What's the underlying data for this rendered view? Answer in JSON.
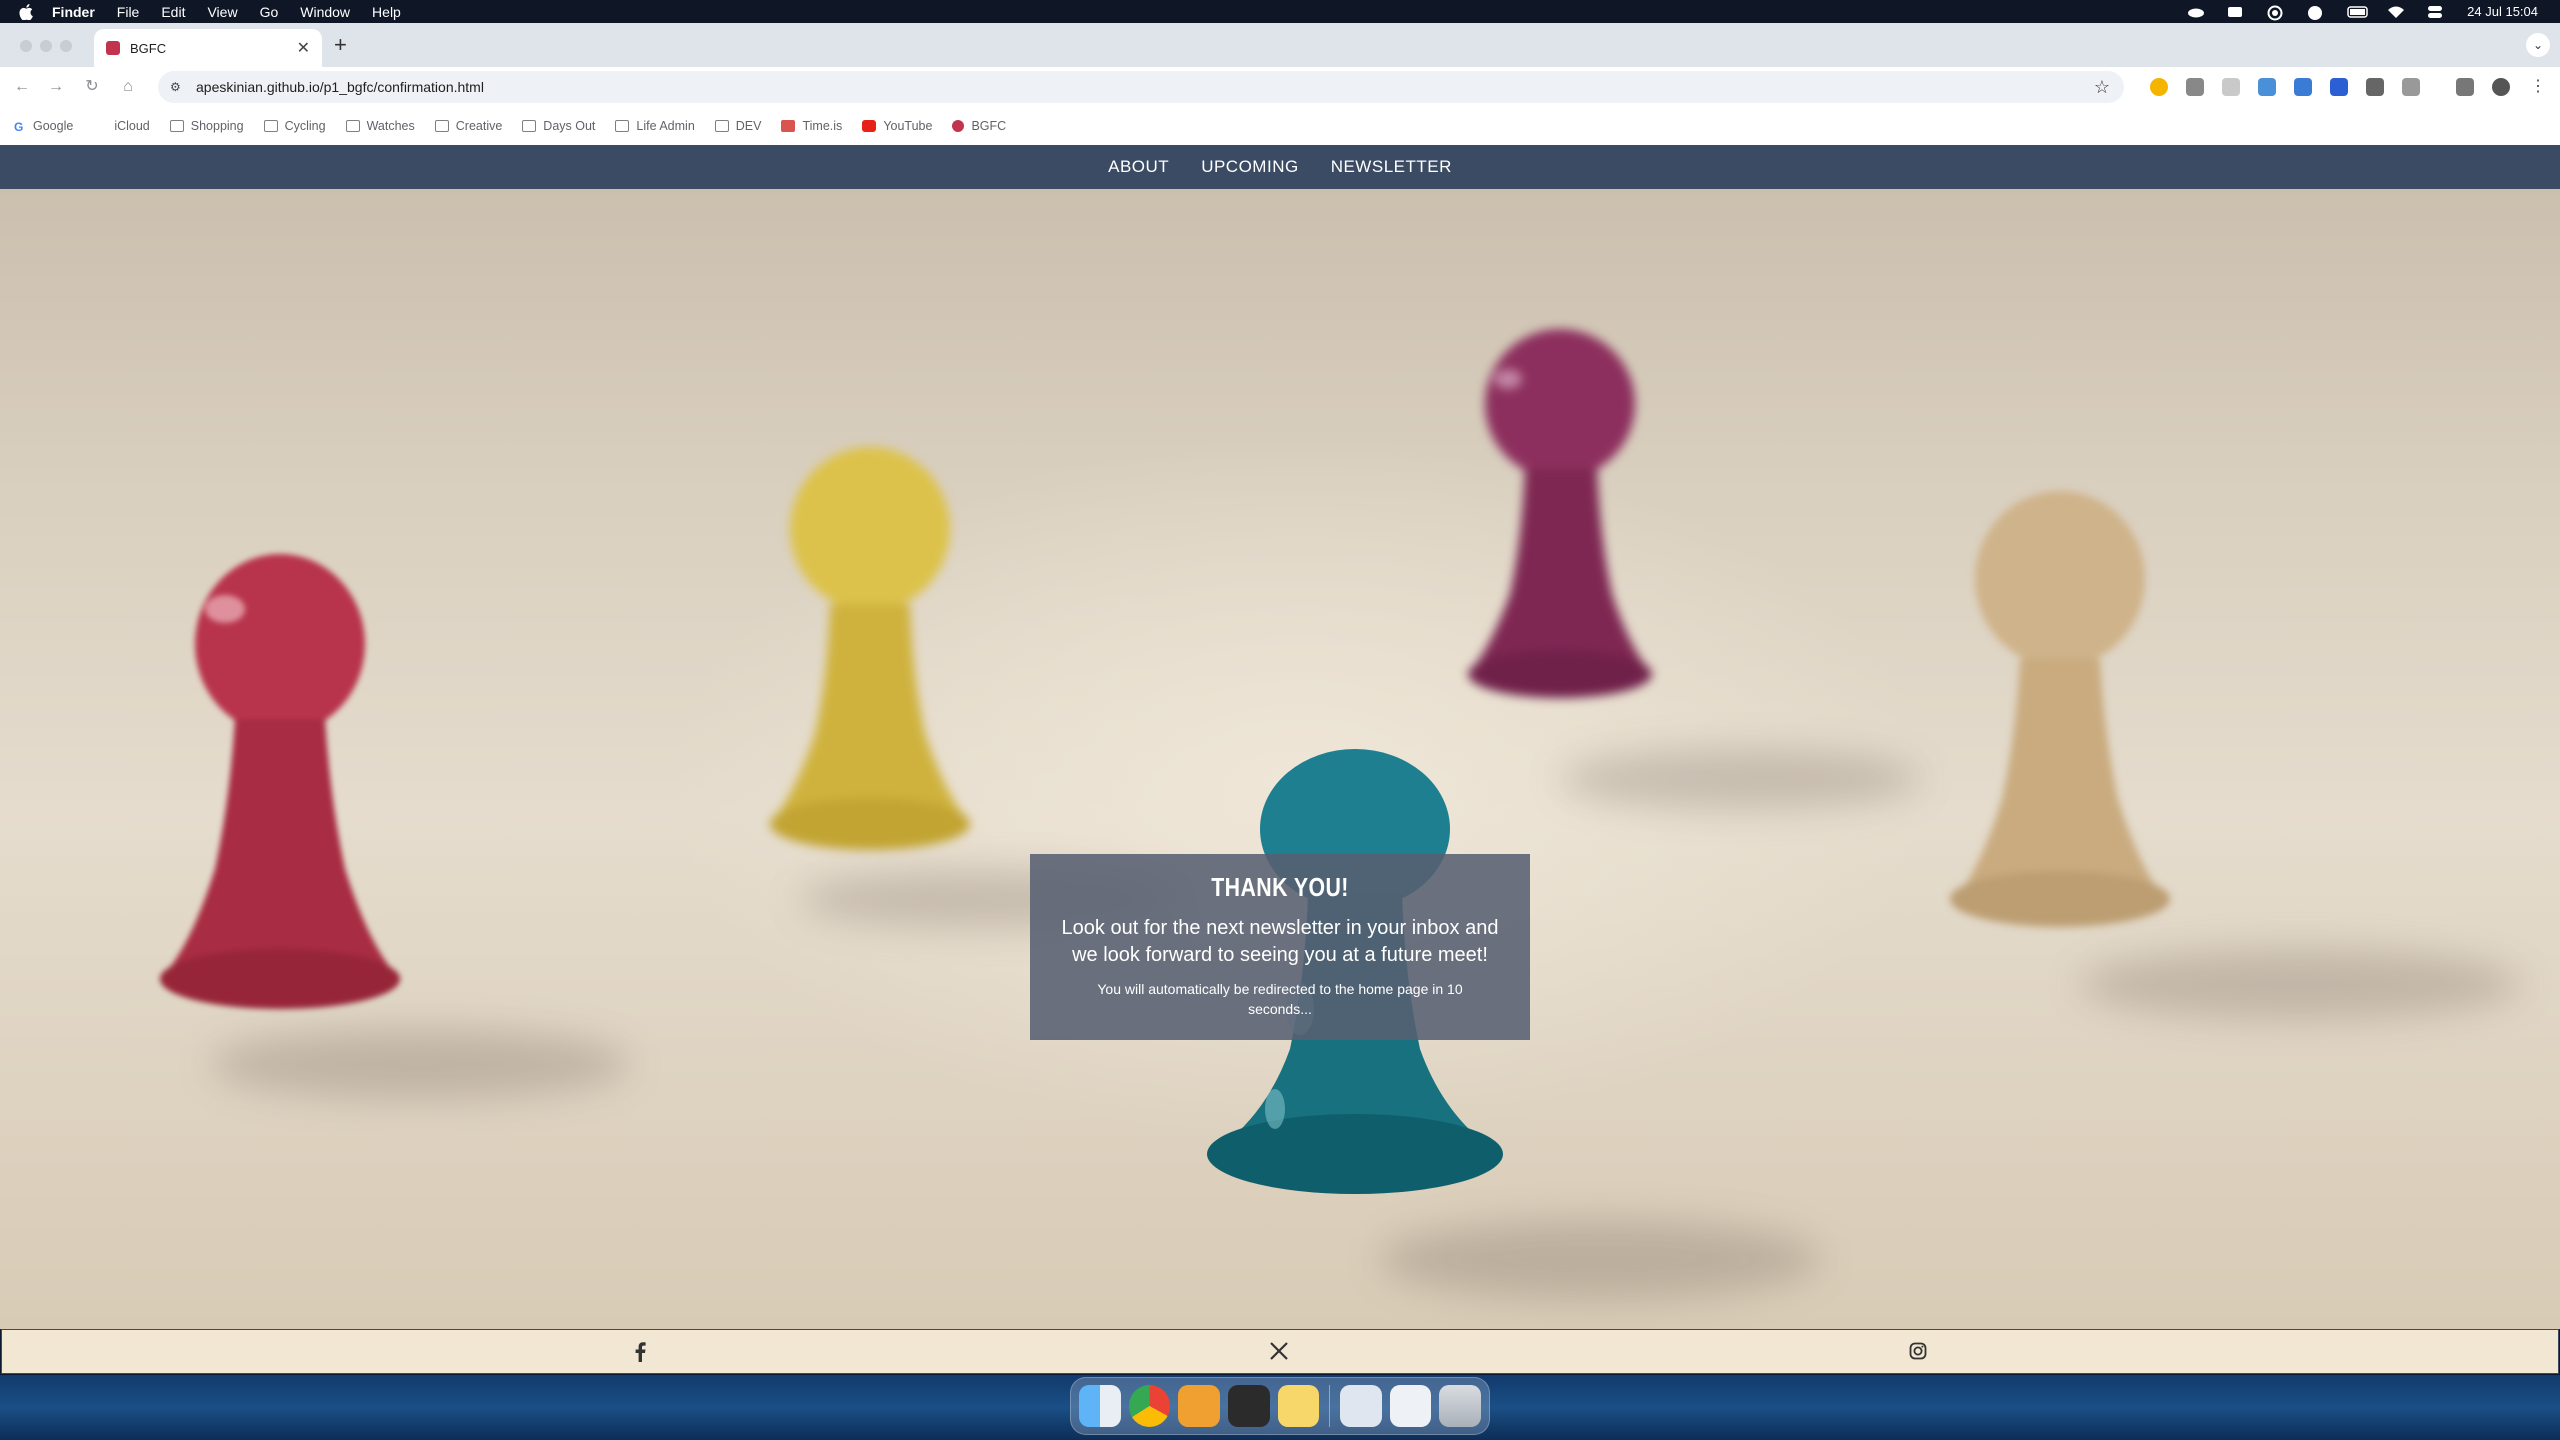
{
  "menubar": {
    "app_name": "Finder",
    "items": [
      "File",
      "Edit",
      "View",
      "Go",
      "Window",
      "Help"
    ],
    "clock": "24 Jul  15:04"
  },
  "browser": {
    "tab_title": "BGFC",
    "url": "apeskinian.github.io/p1_bgfc/confirmation.html",
    "bookmarks": [
      "Google",
      "iCloud",
      "Shopping",
      "Cycling",
      "Watches",
      "Creative",
      "Days Out",
      "Life Admin",
      "DEV",
      "Time.is",
      "YouTube",
      "BGFC"
    ]
  },
  "site": {
    "nav": {
      "about": "ABOUT",
      "upcoming": "UPCOMING",
      "newsletter": "NEWSLETTER"
    },
    "confirmation": {
      "title": "THANK YOU!",
      "message": "Look out for the next newsletter in your inbox and we look forward to seeing you at a future meet!",
      "redirect": "You will automatically be redirected to the home page in 10 seconds..."
    },
    "footer": {
      "social_icons": [
        "facebook-icon",
        "x-icon",
        "instagram-icon"
      ]
    }
  },
  "colors": {
    "nav_bg": "#3c4b64",
    "footer_bg": "#f1e7d3",
    "confirm_bg": "#586072"
  }
}
